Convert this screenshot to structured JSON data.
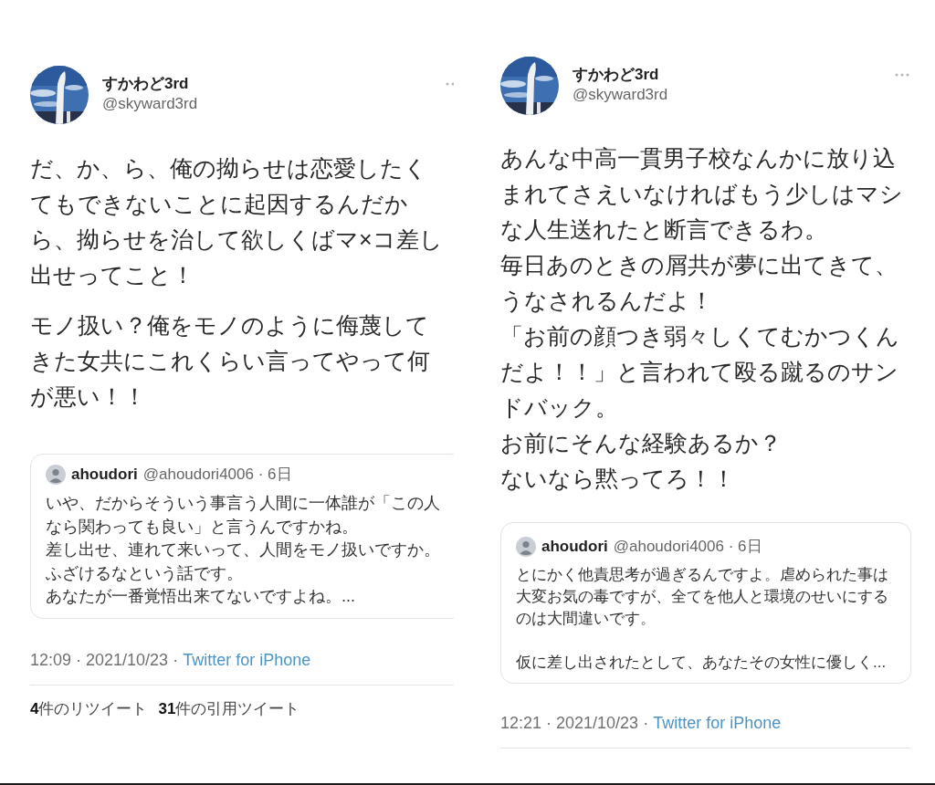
{
  "tweets": [
    {
      "author": {
        "name": "すかわど3rd",
        "handle": "@skyward3rd"
      },
      "paragraphs": [
        [
          "だ、か、ら、俺の拗らせは恋愛したくてもできないことに起因するんだから、拗らせを治して欲しくばマ×コ差し出せってこと！"
        ],
        [
          "モノ扱い？俺をモノのように侮蔑してきた女共にこれくらい言ってやって何が悪い！！"
        ]
      ],
      "quote": {
        "name": "ahoudori",
        "meta": "@ahoudori4006 · 6日",
        "paragraphs": [
          [
            "いや、だからそういう事言う人間に一体誰が「この人なら関わっても良い」と言うんですかね。",
            "差し出せ、連れて来いって、人間をモノ扱いですか。",
            "ふざけるなという話です。",
            "あなたが一番覚悟出来てないですよね。..."
          ]
        ]
      },
      "timestamp": "12:09 · 2021/10/23 ·",
      "source": "Twitter for iPhone",
      "stats": [
        "**4**件のリツイート",
        "**31**件の引用ツイート"
      ]
    },
    {
      "author": {
        "name": "すかわど3rd",
        "handle": "@skyward3rd"
      },
      "paragraphs": [
        [
          "あんな中高一貫男子校なんかに放り込まれてさえいなければもう少しはマシな人生送れたと断言できるわ。",
          "毎日あのときの屑共が夢に出てきて、",
          "うなされるんだよ！",
          "「お前の顔つき弱々しくてむかつくんだよ！！」と言われて殴る蹴るのサンドバック。",
          "お前にそんな経験あるか？",
          "ないなら黙ってろ！！"
        ]
      ],
      "quote": {
        "name": "ahoudori",
        "meta": "@ahoudori4006 · 6日",
        "paragraphs": [
          [
            "とにかく他責思考が過ぎるんですよ。虐められた事は大変お気の毒ですが、全てを他人と環境のせいにするのは大間違いです。"
          ],
          [
            "仮に差し出されたとして、あなたその女性に優しく..."
          ]
        ]
      },
      "timestamp": "12:21 · 2021/10/23 ·",
      "source": "Twitter for iPhone"
    }
  ]
}
